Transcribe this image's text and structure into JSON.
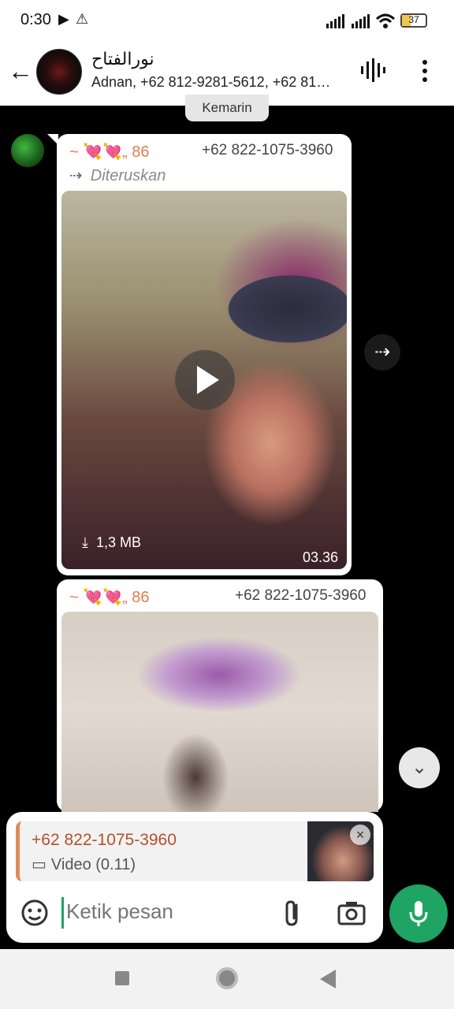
{
  "status": {
    "time": "0:30",
    "battery": "37"
  },
  "header": {
    "title": "نورالفتاح",
    "subtitle": "Adnan, +62 812-9281-5612, +62 81…"
  },
  "date_chip": "Kemarin",
  "messages": [
    {
      "sender_name": "~ 💘💘„ 86",
      "sender_phone": "+62 822-1075-3960",
      "forward_label": "Diteruskan",
      "size": "1,3 MB",
      "duration": "03.36"
    },
    {
      "sender_name": "~ 💘💘„ 86",
      "sender_phone": "+62 822-1075-3960"
    }
  ],
  "reply": {
    "name": "+62 822-1075-3960",
    "type": "Video (0.11)"
  },
  "compose": {
    "placeholder": "Ketik pesan"
  },
  "colors": {
    "accent": "#1fa463",
    "sender": "#e27c52"
  }
}
